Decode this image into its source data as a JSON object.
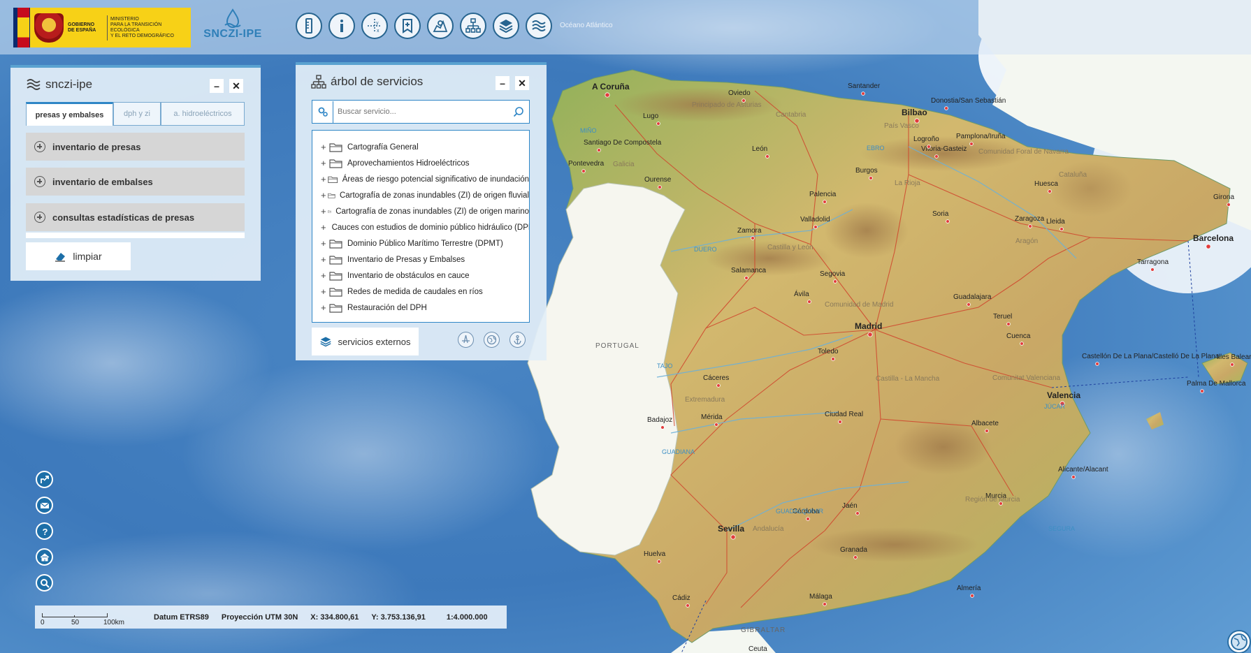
{
  "header": {
    "gov_logo": {
      "line1": [
        "GOBIERNO",
        "DE ESPAÑA"
      ],
      "line2": [
        "MINISTERIO",
        "PARA LA TRANSICIÓN ECOLÓGICA",
        "Y EL RETO DEMOGRÁFICO"
      ]
    },
    "app_logo": "SNCZI-IPE",
    "tool_hint": "Océano Atlántico",
    "tools": [
      {
        "name": "measure-icon"
      },
      {
        "name": "info-icon"
      },
      {
        "name": "coordinates-icon"
      },
      {
        "name": "bookmark-icon"
      },
      {
        "name": "map-search-icon"
      },
      {
        "name": "service-tree-icon"
      },
      {
        "name": "layers-icon"
      },
      {
        "name": "sncz-waves-icon"
      }
    ]
  },
  "panel_sncz": {
    "title": "snczi-ipe",
    "tabs": [
      "presas y embalses",
      "dph y zi",
      "a. hidroeléctricos"
    ],
    "sections": [
      "inventario de presas",
      "inventario de embalses",
      "consultas estadísticas de presas"
    ],
    "clear_label": "limpiar"
  },
  "panel_tree": {
    "title": "árbol de servicios",
    "search_placeholder": "Buscar servicio...",
    "items": [
      "Cartografía General",
      "Aprovechamientos Hidroeléctricos",
      "Áreas de riesgo potencial significativo de inundación",
      "Cartografía de zonas inundables (ZI) de origen fluvial",
      "Cartografía de zonas inundables (ZI) de origen marino",
      "Cauces con estudios de dominio público hidráulico (DPH)",
      "Dominio Público Marítimo Terrestre (DPMT)",
      "Inventario de Presas y Embalses",
      "Inventario de obstáculos en cauce",
      "Redes de medida de caudales en ríos",
      "Restauración del DPH"
    ],
    "external_label": "servicios externos"
  },
  "side_buttons": [
    "share-icon",
    "email-icon",
    "help-icon",
    "home-icon",
    "zoom-search-icon"
  ],
  "status_bar": {
    "scale_ticks": [
      "0",
      "50",
      "100km"
    ],
    "datum": "Datum ETRS89",
    "projection": "Proyección UTM 30N",
    "x": "X: 334.800,61",
    "y": "Y: 3.753.136,91",
    "scale": "1:4.000.000"
  },
  "map": {
    "country_labels": [
      "PORTUGAL",
      "GIBRALTAR"
    ],
    "regions": [
      "Principado de Asturias",
      "Cantabria",
      "País Vasco",
      "Comunidad Foral de Navarra",
      "Castilla y León",
      "La Rioja",
      "Aragón",
      "Cataluña",
      "Comunidad de Madrid",
      "Castilla - La Mancha",
      "Extremadura",
      "Comunitat Valenciana",
      "Andalucía",
      "Región de Murcia",
      "Galicia"
    ],
    "rivers": [
      "DUERO",
      "EBRO",
      "TAJO",
      "GUADIANA",
      "GUADALQUIVIR",
      "JÚCAR",
      "MIÑO",
      "SEGURA"
    ],
    "cities": [
      {
        "name": "A Coruña",
        "major": true
      },
      {
        "name": "Oviedo"
      },
      {
        "name": "Santander"
      },
      {
        "name": "Donostia/San Sebastián"
      },
      {
        "name": "Bilbao",
        "major": true
      },
      {
        "name": "Lugo"
      },
      {
        "name": "Santiago De Compostela"
      },
      {
        "name": "Pontevedra"
      },
      {
        "name": "Ourense"
      },
      {
        "name": "León"
      },
      {
        "name": "Vitoria-Gasteiz"
      },
      {
        "name": "Pamplona/Iruña"
      },
      {
        "name": "Logroño"
      },
      {
        "name": "Burgos"
      },
      {
        "name": "Huesca"
      },
      {
        "name": "Girona"
      },
      {
        "name": "Palencia"
      },
      {
        "name": "Soria"
      },
      {
        "name": "Zaragoza"
      },
      {
        "name": "Lleida"
      },
      {
        "name": "Barcelona",
        "major": true
      },
      {
        "name": "Tarragona"
      },
      {
        "name": "Valladolid"
      },
      {
        "name": "Zamora"
      },
      {
        "name": "Salamanca"
      },
      {
        "name": "Segovia"
      },
      {
        "name": "Ávila"
      },
      {
        "name": "Guadalajara"
      },
      {
        "name": "Madrid",
        "major": true
      },
      {
        "name": "Teruel"
      },
      {
        "name": "Castellón De La Plana/Castelló De La Plana"
      },
      {
        "name": "Toledo"
      },
      {
        "name": "Cuenca"
      },
      {
        "name": "Cáceres"
      },
      {
        "name": "Valencia",
        "major": true
      },
      {
        "name": "Palma De Mallorca"
      },
      {
        "name": "Illes Balears"
      },
      {
        "name": "Badajoz"
      },
      {
        "name": "Mérida"
      },
      {
        "name": "Ciudad Real"
      },
      {
        "name": "Albacete"
      },
      {
        "name": "Alicante/Alacant"
      },
      {
        "name": "Murcia"
      },
      {
        "name": "Córdoba"
      },
      {
        "name": "Jaén"
      },
      {
        "name": "Sevilla",
        "major": true
      },
      {
        "name": "Huelva"
      },
      {
        "name": "Granada"
      },
      {
        "name": "Almería"
      },
      {
        "name": "Málaga"
      },
      {
        "name": "Cádiz"
      },
      {
        "name": "Ceuta"
      }
    ]
  },
  "colors": {
    "accent": "#2f86c6",
    "panel_bg": "#e2eef8",
    "sea": "#3a78b8",
    "land": "#c9b36d",
    "road": "#d0442c"
  }
}
